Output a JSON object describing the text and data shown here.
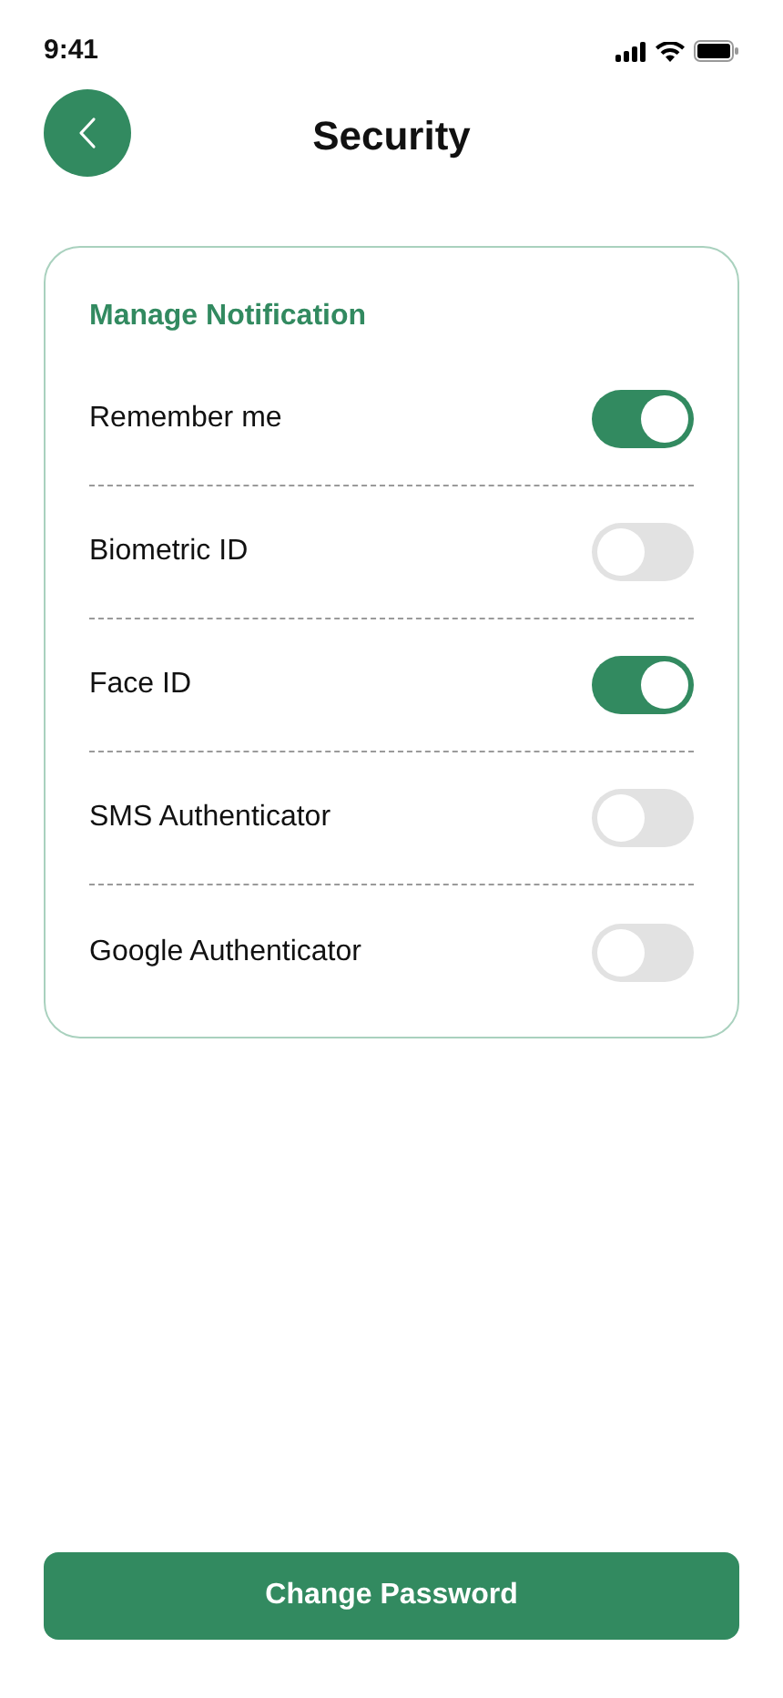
{
  "status_bar": {
    "time": "9:41"
  },
  "header": {
    "title": "Security"
  },
  "card": {
    "heading": "Manage Notification",
    "settings": [
      {
        "label": "Remember me",
        "on": true
      },
      {
        "label": "Biometric ID",
        "on": false
      },
      {
        "label": "Face ID",
        "on": true
      },
      {
        "label": "SMS Authenticator",
        "on": false
      },
      {
        "label": "Google Authenticator",
        "on": false
      }
    ]
  },
  "primary_button": {
    "label": "Change Password"
  }
}
